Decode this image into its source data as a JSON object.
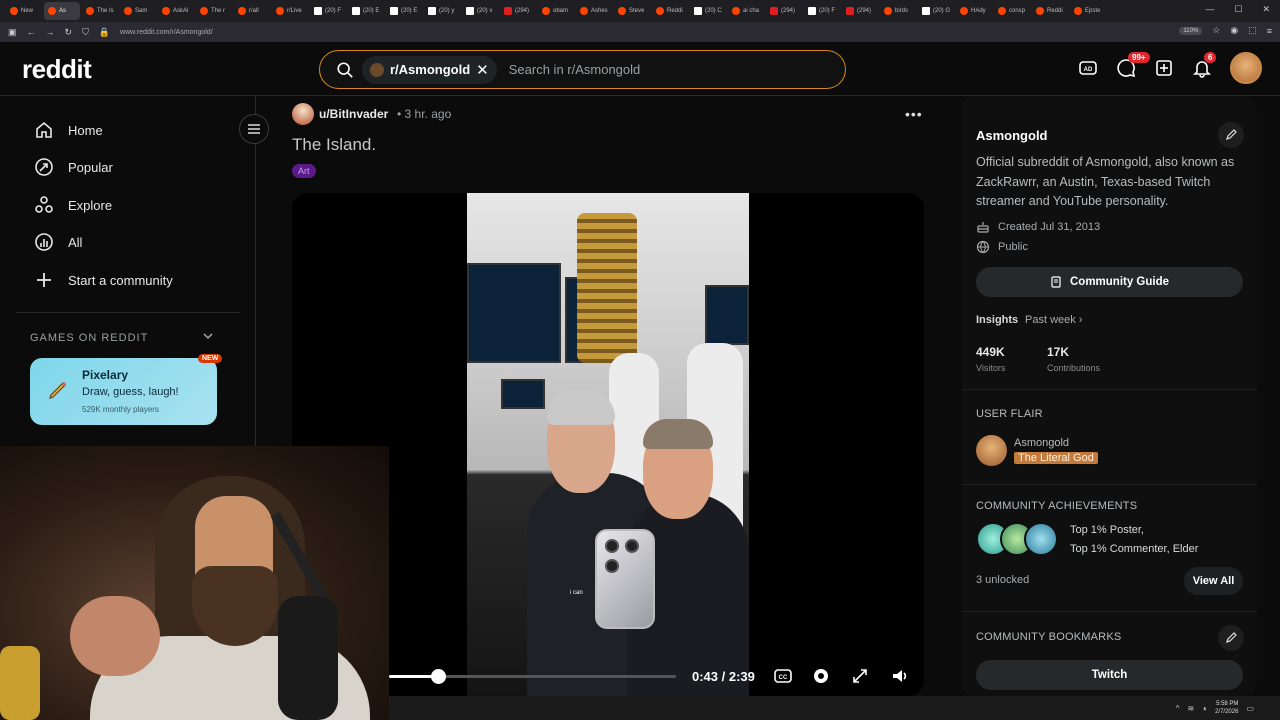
{
  "browser": {
    "tabs": [
      "New",
      "As",
      "The Is",
      "Sam",
      "AskAl",
      "The r",
      "r/all",
      "r/Live",
      "(20) F",
      "(20) E",
      "(20) E",
      "(20) y",
      "(20) v",
      "(294)",
      "obam",
      "Ashes",
      "Steve",
      "Reddi",
      "(20) C",
      "ai cha",
      "(294)",
      "(20) F",
      "(294)",
      "birds",
      "(20) G",
      "HAdy",
      "consp",
      "Reddi",
      "Epste"
    ],
    "active_tab": 1,
    "url": "www.reddit.com/r/Asmongold/",
    "zoom": "110%"
  },
  "header": {
    "logo": "reddit",
    "search_chip": "r/Asmongold",
    "search_chip_close": "✕",
    "search_placeholder": "Search in r/Asmongold",
    "chat_badge": "99+",
    "notif_badge": "6"
  },
  "sidebar": {
    "items": [
      {
        "label": "Home",
        "icon": "home-icon"
      },
      {
        "label": "Popular",
        "icon": "popular-icon"
      },
      {
        "label": "Explore",
        "icon": "explore-icon"
      },
      {
        "label": "All",
        "icon": "all-icon"
      },
      {
        "label": "Start a community",
        "icon": "plus-icon"
      }
    ],
    "games_heading": "GAMES ON REDDIT",
    "game": {
      "title": "Pixelary",
      "subtitle": "Draw, guess, laugh!",
      "players": "529K monthly players",
      "badge": "NEW"
    }
  },
  "post": {
    "author": "u/BitInvader",
    "time": "• 3 hr. ago",
    "more": "•••",
    "title": "The Island.",
    "flair": "Art",
    "video_caption": "i can",
    "video": {
      "current": "0:43",
      "total": "2:39",
      "progress": 0.17
    }
  },
  "community": {
    "name": "Asmongold",
    "description": "Official subreddit of Asmongold, also known as ZackRawrr, an Austin, Texas-based Twitch streamer and YouTube personality.",
    "created": "Created Jul 31, 2013",
    "visibility": "Public",
    "guide_button": "Community Guide",
    "insights_label": "Insights",
    "insights_period": "Past week ›",
    "visitors_value": "449K",
    "visitors_label": "Visitors",
    "contributions_value": "17K",
    "contributions_label": "Contributions",
    "user_flair_heading": "USER FLAIR",
    "user_name": "Asmongold",
    "user_flair": "The Literal God",
    "achievements_heading": "COMMUNITY ACHIEVEMENTS",
    "achievement_1": "Top 1% Poster,",
    "achievement_2": "Top 1% Commenter, Elder",
    "unlocked": "3 unlocked",
    "view_all": "View All",
    "bookmarks_heading": "COMMUNITY BOOKMARKS",
    "bookmark_1": "Twitch"
  },
  "taskbar": {
    "time": "5:58 PM",
    "date": "2/7/2026"
  },
  "colors": {
    "search_border": "#d98a1a",
    "badge_red": "#e0282d",
    "flair_purple": "#5a1a8a",
    "user_flair_bg": "#c47a3a",
    "game_card": "#7fd6ea"
  }
}
